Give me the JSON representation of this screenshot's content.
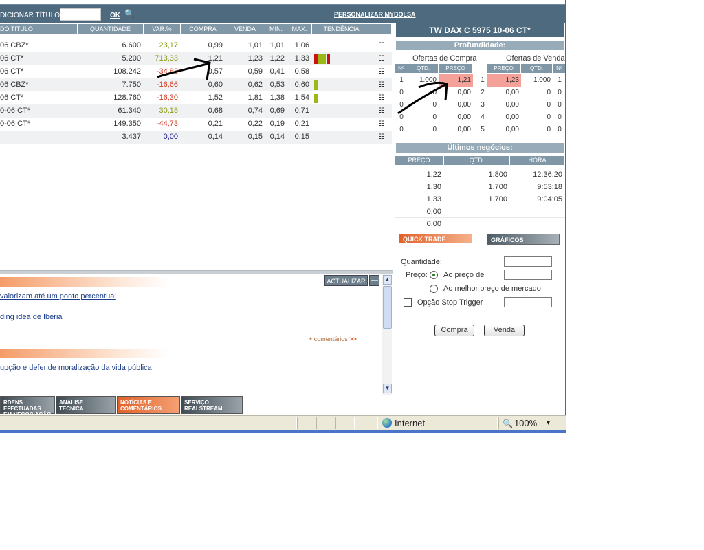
{
  "topbar": {
    "add_title_label": "DICIONAR TÍTULO",
    "ok_label": "OK",
    "personalize_link": "PERSONALIZAR MYBOLSA",
    "search_icon": "magnifier-icon"
  },
  "table": {
    "headers": [
      "DO TITULO",
      "QUANTIDADE",
      "VAR.%",
      "COMPRA",
      "VENDA",
      "MIN.",
      "MAX.",
      "TENDÊNCIA"
    ],
    "rows": [
      {
        "title": "06 CBZ*",
        "qty": "6.600",
        "var": "23,17",
        "var_sign": "pos",
        "buy": "0,99",
        "sell": "1,01",
        "min": "1,01",
        "max": "1,06",
        "trend": []
      },
      {
        "title": "06 CT*",
        "qty": "5.200",
        "var": "713,33",
        "var_sign": "pos",
        "buy": "1,21",
        "sell": "1,23",
        "min": "1,22",
        "max": "1,33",
        "trend": [
          "red",
          "green",
          "green",
          "red"
        ]
      },
      {
        "title": "06 CT*",
        "qty": "108.242",
        "var": "-34,83",
        "var_sign": "neg",
        "buy": "0,57",
        "sell": "0,59",
        "min": "0,41",
        "max": "0,58",
        "trend": []
      },
      {
        "title": "06 CBZ*",
        "qty": "7.750",
        "var": "-16,66",
        "var_sign": "neg",
        "buy": "0,60",
        "sell": "0,62",
        "min": "0,53",
        "max": "0,60",
        "trend": [
          "green"
        ]
      },
      {
        "title": "06 CT*",
        "qty": "128.760",
        "var": "-16,30",
        "var_sign": "neg",
        "buy": "1,52",
        "sell": "1,81",
        "min": "1,38",
        "max": "1,54",
        "trend": [
          "green"
        ]
      },
      {
        "title": "0-06 CT*",
        "qty": "61.340",
        "var": "30,18",
        "var_sign": "pos",
        "buy": "0,68",
        "sell": "0,74",
        "min": "0,69",
        "max": "0,71",
        "trend": []
      },
      {
        "title": "0-06 CT*",
        "qty": "149.350",
        "var": "-44,73",
        "var_sign": "neg",
        "buy": "0,21",
        "sell": "0,22",
        "min": "0,19",
        "max": "0,21",
        "trend": []
      },
      {
        "title": "",
        "qty": "3.437",
        "var": "0,00",
        "var_sign": "zero",
        "buy": "0,14",
        "sell": "0,15",
        "min": "0,14",
        "max": "0,15",
        "trend": []
      }
    ],
    "row_icon": "options-grid-icon"
  },
  "panel": {
    "title": "TW DAX C 5975 10-06 CT*",
    "depth_label": "Profundidade:",
    "buy_offers_label": "Ofertas de Compra",
    "sell_offers_label": "Ofertas de Venda",
    "depth_headers": [
      "Nº",
      "QTD.",
      "PREÇO",
      "PREÇO",
      "QTD.",
      "Nº"
    ],
    "depth_rows": [
      {
        "n1": "1",
        "q1": "1.000",
        "p1": "1,21",
        "idx": "1",
        "p2": "1,23",
        "q2": "1.000",
        "n2": "1"
      },
      {
        "n1": "0",
        "q1": "0",
        "p1": "0,00",
        "idx": "2",
        "p2": "0,00",
        "q2": "0",
        "n2": "0"
      },
      {
        "n1": "0",
        "q1": "0",
        "p1": "0,00",
        "idx": "3",
        "p2": "0,00",
        "q2": "0",
        "n2": "0"
      },
      {
        "n1": "0",
        "q1": "0",
        "p1": "0,00",
        "idx": "4",
        "p2": "0,00",
        "q2": "0",
        "n2": "0"
      },
      {
        "n1": "0",
        "q1": "0",
        "p1": "0,00",
        "idx": "5",
        "p2": "0,00",
        "q2": "0",
        "n2": "0"
      }
    ],
    "last_trades_label": "Últimos negócios:",
    "last_headers": [
      "PREÇO",
      "QTD.",
      "HORA"
    ],
    "last_rows": [
      {
        "price": "1,22",
        "qty": "1.800",
        "time": "12:36:20"
      },
      {
        "price": "1,30",
        "qty": "1.700",
        "time": "9:53:18"
      },
      {
        "price": "1,33",
        "qty": "1.700",
        "time": "9:04:05"
      },
      {
        "price": "0,00",
        "qty": "",
        "time": ""
      },
      {
        "price": "0,00",
        "qty": "",
        "time": ""
      }
    ],
    "quick_trade_label": "QUICK TRADE",
    "graphs_label": "GRÁFICOS",
    "quantity_label": "Quantidade:",
    "price_label": "Preço:",
    "at_price_label": "Ao preço de",
    "market_price_label": "Ao melhor preço de mercado",
    "stop_trigger_label": "Opção Stop Trigger",
    "buy_button": "Compra",
    "sell_button": "Venda"
  },
  "news": {
    "update_button": "ACTUALIZAR",
    "minimize_glyph": "—",
    "links": [
      "valorizam até um ponto percentual",
      "ding idea de Iberia",
      "upção e defende moralização da vida pública"
    ],
    "comments_label": "+ comentários",
    "comments_arrow": ">>"
  },
  "tabs": [
    {
      "line1": "RDENS EFECTUADAS",
      "line2": "EM NEGOCIAÇÃO"
    },
    {
      "line1": "ANÁLISE",
      "line2": "TÉCNICA"
    },
    {
      "line1": "NOTÍCIAS E",
      "line2": "COMENTÁRIOS"
    },
    {
      "line1": "SERVIÇO",
      "line2": "REALSTREAM"
    }
  ],
  "status": {
    "zone": "Internet",
    "zoom": "100%",
    "zoom_arrow": "▾",
    "globe_icon": "globe-icon",
    "zoom_icon": "zoom-icon"
  },
  "colors": {
    "header_bg": "#4d6a7e",
    "positive": "#8a9b12",
    "negative": "#d23a20",
    "highlight": "#f4a19a",
    "accent": "#e0622a"
  }
}
